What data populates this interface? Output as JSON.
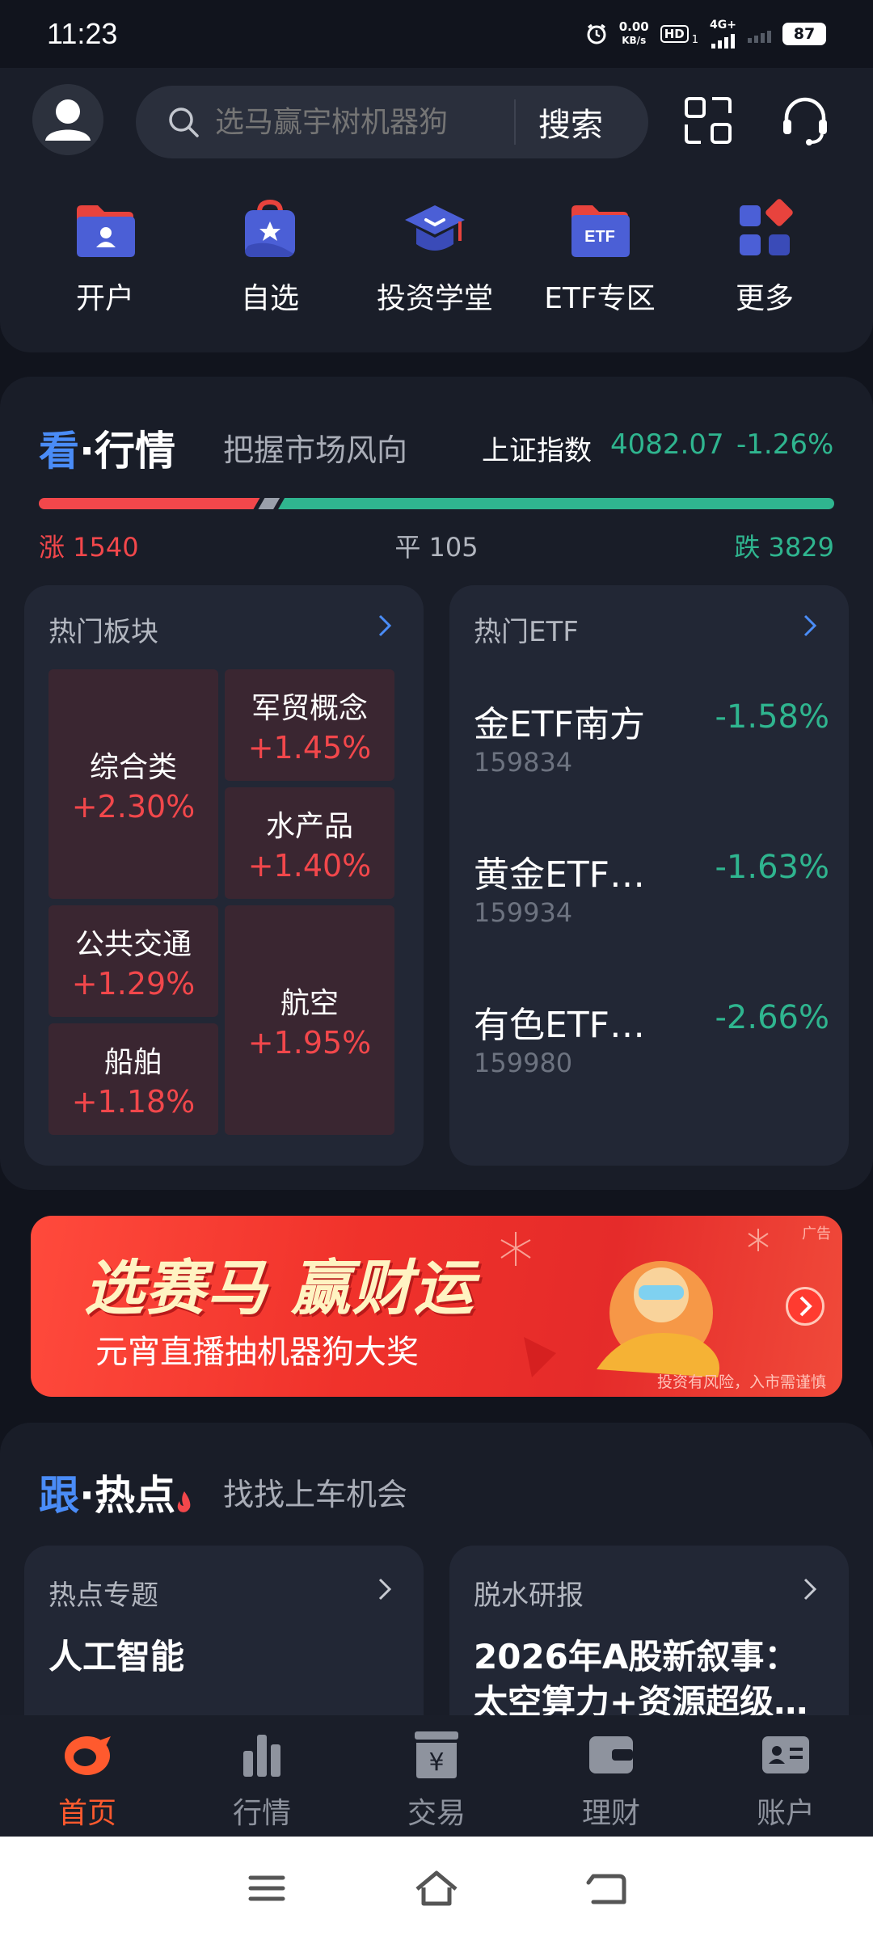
{
  "status_bar": {
    "time": "11:23",
    "net_speed_value": "0.00",
    "net_speed_unit": "KB/s",
    "hd": "HD",
    "hd_sub": "1",
    "network": "4G+",
    "battery": "87"
  },
  "header": {
    "search_placeholder": "选马赢宇树机器狗",
    "search_button": "搜索"
  },
  "quick_actions": [
    {
      "label": "开户",
      "icon": "open-account-folder-icon"
    },
    {
      "label": "自选",
      "icon": "watchlist-bag-icon"
    },
    {
      "label": "投资学堂",
      "icon": "graduation-cap-icon"
    },
    {
      "label": "ETF专区",
      "icon": "etf-folder-icon"
    },
    {
      "label": "更多",
      "icon": "more-grid-icon"
    }
  ],
  "market": {
    "title_accent": "看",
    "title_rest": "·行情",
    "subtitle": "把握市场风向",
    "index_name": "上证指数",
    "index_value": "4082.07",
    "index_change": "-1.26%",
    "breadth": {
      "up_label": "涨 1540",
      "flat_label": "平 105",
      "down_label": "跌 3829",
      "up": 1540,
      "flat": 105,
      "down": 3829
    },
    "hot_sectors": {
      "title": "热门板块",
      "tiles": [
        {
          "name": "综合类",
          "pct": "+2.30%"
        },
        {
          "name": "军贸概念",
          "pct": "+1.45%"
        },
        {
          "name": "水产品",
          "pct": "+1.40%"
        },
        {
          "name": "公共交通",
          "pct": "+1.29%"
        },
        {
          "name": "航空",
          "pct": "+1.95%"
        },
        {
          "name": "船舶",
          "pct": "+1.18%"
        }
      ]
    },
    "hot_etf": {
      "title": "热门ETF",
      "items": [
        {
          "name": "金ETF南方",
          "code": "159834",
          "pct": "-1.58%"
        },
        {
          "name": "黄金ETF…",
          "code": "159934",
          "pct": "-1.63%"
        },
        {
          "name": "有色ETF…",
          "code": "159980",
          "pct": "-2.66%"
        }
      ]
    }
  },
  "banner": {
    "title": "选赛马 赢财运",
    "subtitle": "元宵直播抽机器狗大奖",
    "ad_tag": "广告",
    "risk_note": "投资有风险，入市需谨慎"
  },
  "hotspot": {
    "title_accent": "跟",
    "title_rest": "·热点",
    "subtitle": "找找上车机会",
    "topics": {
      "title": "热点专题",
      "headline": "人工智能"
    },
    "reports": {
      "title": "脱水研报",
      "headline": "2026年A股新叙事：太空算力+资源超级…"
    }
  },
  "bottom_nav": [
    {
      "label": "首页",
      "active": true
    },
    {
      "label": "行情",
      "active": false
    },
    {
      "label": "交易",
      "active": false
    },
    {
      "label": "理财",
      "active": false
    },
    {
      "label": "账户",
      "active": false
    }
  ],
  "colors": {
    "up": "#f2474b",
    "down": "#2fb58f",
    "accent_blue": "#4a8cf7",
    "active_nav": "#ff5a2e"
  }
}
